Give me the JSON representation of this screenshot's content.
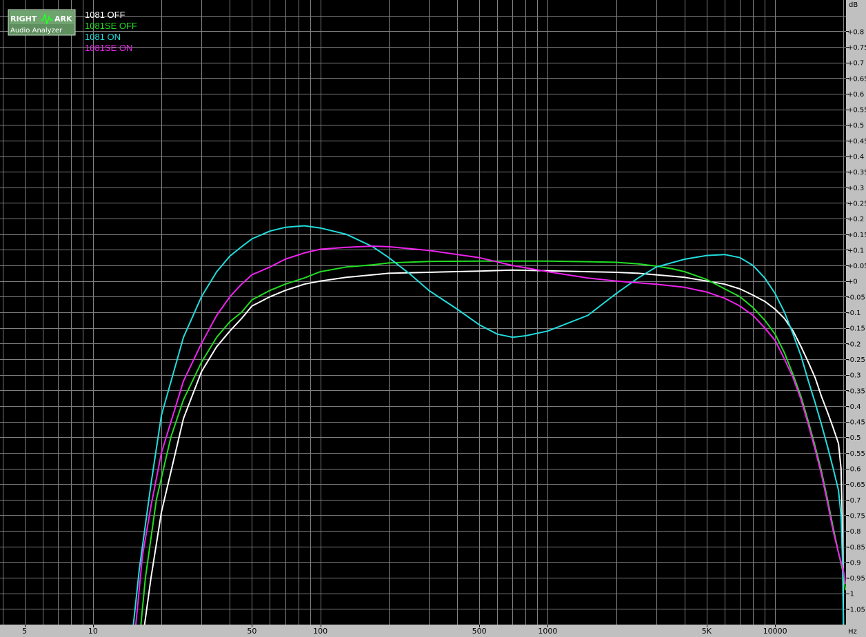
{
  "logo": {
    "line1_left": "RIGHT",
    "line1_right": "ARK",
    "line2": "Audio Analyzer"
  },
  "chart_data": {
    "type": "line",
    "xscale": "log",
    "xlim": [
      3.9,
      20500
    ],
    "ylim": [
      -1.1,
      0.9
    ],
    "ylabel": "dB",
    "xlabel": "Hz",
    "grid": true,
    "legend_position": "top-left",
    "x_ticks": [
      {
        "v": 5,
        "label": "5"
      },
      {
        "v": 10,
        "label": "10"
      },
      {
        "v": 50,
        "label": "50"
      },
      {
        "v": 100,
        "label": "100"
      },
      {
        "v": 500,
        "label": "500"
      },
      {
        "v": 1000,
        "label": "1000"
      },
      {
        "v": 5000,
        "label": "5K"
      },
      {
        "v": 10000,
        "label": "10000"
      }
    ],
    "y_ticks": [
      {
        "v": 0.8,
        "label": "+0.8"
      },
      {
        "v": 0.75,
        "label": "+0.75"
      },
      {
        "v": 0.7,
        "label": "+0.7"
      },
      {
        "v": 0.65,
        "label": "+0.65"
      },
      {
        "v": 0.6,
        "label": "+0.6"
      },
      {
        "v": 0.55,
        "label": "+0.55"
      },
      {
        "v": 0.5,
        "label": "+0.5"
      },
      {
        "v": 0.45,
        "label": "+0.45"
      },
      {
        "v": 0.4,
        "label": "+0.4"
      },
      {
        "v": 0.35,
        "label": "+0.35"
      },
      {
        "v": 0.3,
        "label": "+0.3"
      },
      {
        "v": 0.25,
        "label": "+0.25"
      },
      {
        "v": 0.2,
        "label": "+0.2"
      },
      {
        "v": 0.15,
        "label": "+0.15"
      },
      {
        "v": 0.1,
        "label": "+0.1"
      },
      {
        "v": 0.05,
        "label": "+0.05"
      },
      {
        "v": 0,
        "label": "+0"
      },
      {
        "v": -0.05,
        "label": "-0.05"
      },
      {
        "v": -0.1,
        "label": "-0.1"
      },
      {
        "v": -0.15,
        "label": "-0.15"
      },
      {
        "v": -0.2,
        "label": "-0.2"
      },
      {
        "v": -0.25,
        "label": "-0.25"
      },
      {
        "v": -0.3,
        "label": "-0.3"
      },
      {
        "v": -0.35,
        "label": "-0.35"
      },
      {
        "v": -0.4,
        "label": "-0.4"
      },
      {
        "v": -0.45,
        "label": "-0.45"
      },
      {
        "v": -0.5,
        "label": "-0.5"
      },
      {
        "v": -0.55,
        "label": "-0.55"
      },
      {
        "v": -0.6,
        "label": "-0.6"
      },
      {
        "v": -0.65,
        "label": "-0.65"
      },
      {
        "v": -0.7,
        "label": "-0.7"
      },
      {
        "v": -0.75,
        "label": "-0.75"
      },
      {
        "v": -0.8,
        "label": "-0.8"
      },
      {
        "v": -0.85,
        "label": "-0.85"
      },
      {
        "v": -0.9,
        "label": "-0.9"
      },
      {
        "v": -0.95,
        "label": "-0.95"
      },
      {
        "v": -1,
        "label": "-1"
      },
      {
        "v": -1.05,
        "label": "-1.05"
      }
    ],
    "series": [
      {
        "name": "1081 OFF",
        "color": "#ffffff",
        "points": [
          [
            16.5,
            -1.15
          ],
          [
            18,
            -0.95
          ],
          [
            20,
            -0.74
          ],
          [
            25,
            -0.44
          ],
          [
            30,
            -0.29
          ],
          [
            35,
            -0.21
          ],
          [
            40,
            -0.16
          ],
          [
            45,
            -0.12
          ],
          [
            50,
            -0.08
          ],
          [
            60,
            -0.05
          ],
          [
            70,
            -0.03
          ],
          [
            85,
            -0.01
          ],
          [
            100,
            0.0
          ],
          [
            130,
            0.012
          ],
          [
            170,
            0.02
          ],
          [
            200,
            0.025
          ],
          [
            300,
            0.028
          ],
          [
            500,
            0.032
          ],
          [
            700,
            0.035
          ],
          [
            1000,
            0.033
          ],
          [
            1500,
            0.03
          ],
          [
            2000,
            0.028
          ],
          [
            2500,
            0.025
          ],
          [
            3000,
            0.02
          ],
          [
            4000,
            0.012
          ],
          [
            5000,
            0.0
          ],
          [
            6000,
            -0.01
          ],
          [
            7000,
            -0.025
          ],
          [
            8000,
            -0.045
          ],
          [
            9000,
            -0.065
          ],
          [
            10000,
            -0.09
          ],
          [
            11000,
            -0.12
          ],
          [
            12000,
            -0.16
          ],
          [
            13000,
            -0.21
          ],
          [
            14000,
            -0.26
          ],
          [
            15000,
            -0.31
          ],
          [
            16000,
            -0.37
          ],
          [
            17000,
            -0.42
          ],
          [
            18000,
            -0.47
          ],
          [
            19000,
            -0.52
          ],
          [
            19500,
            -0.6
          ],
          [
            19800,
            -0.8
          ],
          [
            20000,
            -1.15
          ]
        ]
      },
      {
        "name": "1081SE OFF",
        "color": "#22dd22",
        "points": [
          [
            16,
            -1.15
          ],
          [
            17,
            -0.95
          ],
          [
            19,
            -0.7
          ],
          [
            22,
            -0.5
          ],
          [
            25,
            -0.38
          ],
          [
            30,
            -0.26
          ],
          [
            35,
            -0.18
          ],
          [
            40,
            -0.13
          ],
          [
            45,
            -0.1
          ],
          [
            50,
            -0.06
          ],
          [
            60,
            -0.03
          ],
          [
            70,
            -0.01
          ],
          [
            85,
            0.01
          ],
          [
            100,
            0.03
          ],
          [
            130,
            0.045
          ],
          [
            170,
            0.052
          ],
          [
            200,
            0.058
          ],
          [
            300,
            0.063
          ],
          [
            500,
            0.064
          ],
          [
            1000,
            0.064
          ],
          [
            1500,
            0.062
          ],
          [
            2000,
            0.06
          ],
          [
            2500,
            0.055
          ],
          [
            3000,
            0.048
          ],
          [
            3500,
            0.04
          ],
          [
            4000,
            0.03
          ],
          [
            5000,
            0.005
          ],
          [
            6000,
            -0.025
          ],
          [
            7000,
            -0.05
          ],
          [
            8000,
            -0.085
          ],
          [
            9000,
            -0.125
          ],
          [
            10000,
            -0.17
          ],
          [
            11000,
            -0.23
          ],
          [
            12000,
            -0.3
          ],
          [
            13000,
            -0.37
          ],
          [
            14000,
            -0.45
          ],
          [
            15000,
            -0.53
          ],
          [
            16000,
            -0.61
          ],
          [
            17000,
            -0.7
          ],
          [
            18000,
            -0.79
          ],
          [
            19000,
            -0.87
          ],
          [
            20000,
            -0.94
          ],
          [
            20400,
            -0.99
          ]
        ]
      },
      {
        "name": "1081 ON",
        "color": "#22dddd",
        "points": [
          [
            14.8,
            -1.15
          ],
          [
            16,
            -0.92
          ],
          [
            18,
            -0.65
          ],
          [
            20,
            -0.43
          ],
          [
            25,
            -0.18
          ],
          [
            30,
            -0.05
          ],
          [
            35,
            0.03
          ],
          [
            40,
            0.08
          ],
          [
            45,
            0.11
          ],
          [
            50,
            0.135
          ],
          [
            60,
            0.16
          ],
          [
            70,
            0.172
          ],
          [
            85,
            0.177
          ],
          [
            100,
            0.17
          ],
          [
            130,
            0.15
          ],
          [
            170,
            0.11
          ],
          [
            200,
            0.075
          ],
          [
            250,
            0.02
          ],
          [
            300,
            -0.03
          ],
          [
            400,
            -0.09
          ],
          [
            500,
            -0.14
          ],
          [
            600,
            -0.17
          ],
          [
            700,
            -0.18
          ],
          [
            800,
            -0.175
          ],
          [
            1000,
            -0.16
          ],
          [
            1500,
            -0.11
          ],
          [
            2000,
            -0.04
          ],
          [
            2500,
            0.01
          ],
          [
            3000,
            0.045
          ],
          [
            4000,
            0.07
          ],
          [
            5000,
            0.082
          ],
          [
            6000,
            0.085
          ],
          [
            7000,
            0.075
          ],
          [
            8000,
            0.05
          ],
          [
            9000,
            0.01
          ],
          [
            10000,
            -0.04
          ],
          [
            11000,
            -0.1
          ],
          [
            12000,
            -0.17
          ],
          [
            13000,
            -0.24
          ],
          [
            14000,
            -0.32
          ],
          [
            15000,
            -0.39
          ],
          [
            16000,
            -0.46
          ],
          [
            17000,
            -0.53
          ],
          [
            18000,
            -0.6
          ],
          [
            19000,
            -0.67
          ],
          [
            19500,
            -0.75
          ],
          [
            19800,
            -0.9
          ],
          [
            20000,
            -1.15
          ]
        ]
      },
      {
        "name": "1081SE ON",
        "color": "#ee22ee",
        "points": [
          [
            15.2,
            -1.15
          ],
          [
            16.5,
            -0.88
          ],
          [
            18,
            -0.72
          ],
          [
            20,
            -0.55
          ],
          [
            25,
            -0.32
          ],
          [
            30,
            -0.2
          ],
          [
            35,
            -0.11
          ],
          [
            40,
            -0.05
          ],
          [
            45,
            -0.01
          ],
          [
            50,
            0.02
          ],
          [
            60,
            0.045
          ],
          [
            70,
            0.07
          ],
          [
            85,
            0.09
          ],
          [
            100,
            0.102
          ],
          [
            130,
            0.108
          ],
          [
            170,
            0.112
          ],
          [
            200,
            0.11
          ],
          [
            300,
            0.098
          ],
          [
            500,
            0.075
          ],
          [
            700,
            0.05
          ],
          [
            1000,
            0.03
          ],
          [
            1500,
            0.01
          ],
          [
            2000,
            0.0
          ],
          [
            3000,
            -0.01
          ],
          [
            4000,
            -0.02
          ],
          [
            5000,
            -0.035
          ],
          [
            6000,
            -0.055
          ],
          [
            7000,
            -0.08
          ],
          [
            8000,
            -0.11
          ],
          [
            9000,
            -0.15
          ],
          [
            10000,
            -0.19
          ],
          [
            11000,
            -0.25
          ],
          [
            12000,
            -0.31
          ],
          [
            13000,
            -0.38
          ],
          [
            14000,
            -0.46
          ],
          [
            15000,
            -0.54
          ],
          [
            16000,
            -0.62
          ],
          [
            17000,
            -0.71
          ],
          [
            18000,
            -0.8
          ],
          [
            19000,
            -0.87
          ],
          [
            20000,
            -0.93
          ],
          [
            20400,
            -0.97
          ]
        ]
      }
    ]
  }
}
